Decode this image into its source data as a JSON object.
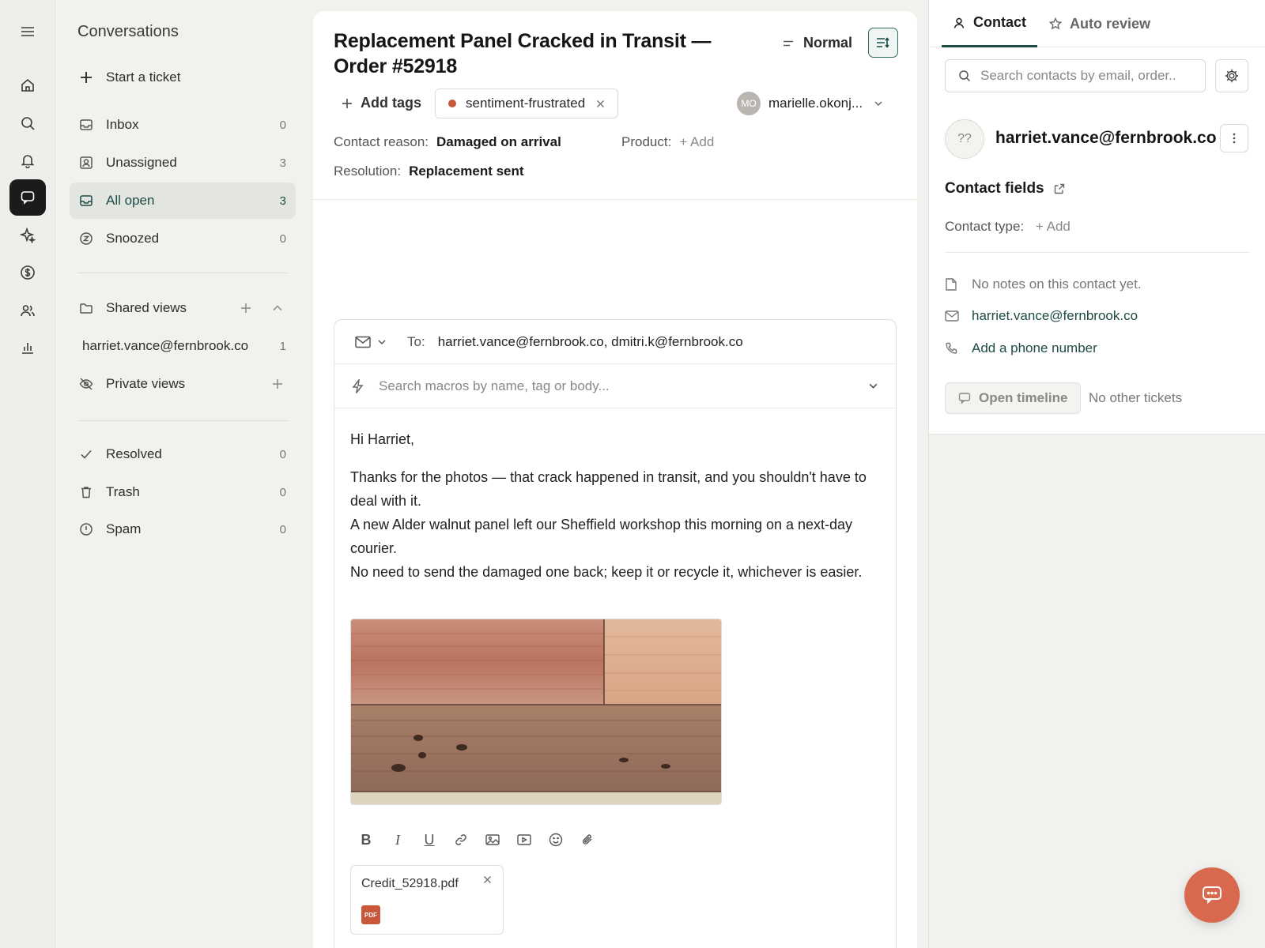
{
  "sidebar": {
    "title": "Conversations",
    "start_ticket": "Start a ticket",
    "items": [
      {
        "label": "Inbox",
        "count": "0"
      },
      {
        "label": "Unassigned",
        "count": "3"
      },
      {
        "label": "All open",
        "count": "3"
      },
      {
        "label": "Snoozed",
        "count": "0"
      }
    ],
    "shared_views": "Shared views",
    "shared_view_item": {
      "label": "harriet.vance@fernbrook.co",
      "count": "1"
    },
    "private_views": "Private views",
    "bottom_items": [
      {
        "label": "Resolved",
        "count": "0"
      },
      {
        "label": "Trash",
        "count": "0"
      },
      {
        "label": "Spam",
        "count": "0"
      }
    ]
  },
  "ticket": {
    "title": "Replacement Panel Cracked in Transit — Order #52918",
    "priority": "Normal",
    "add_tags": "Add tags",
    "tag": "sentiment-frustrated",
    "assignee_initials": "MO",
    "assignee": "marielle.okonj...",
    "contact_reason_label": "Contact reason:",
    "contact_reason_value": "Damaged on arrival",
    "product_label": "Product:",
    "product_add": "+ Add",
    "resolution_label": "Resolution:",
    "resolution_value": "Replacement sent"
  },
  "composer": {
    "to_label": "To:",
    "to_value": "harriet.vance@fernbrook.co, dmitri.k@fernbrook.co",
    "macro_placeholder": "Search macros by name, tag or body...",
    "greeting": "Hi Harriet,",
    "line1": "Thanks for the photos — that crack happened in transit, and you shouldn't have to deal with it.",
    "line2": "A new Alder walnut panel left our Sheffield workshop this morning on a next-day courier.",
    "line3": "No need to send the damaged one back; keep it or recycle it, whichever is easier.",
    "attachment_name": "Credit_52918.pdf",
    "attachment_type": "PDF"
  },
  "right_panel": {
    "tab_contact": "Contact",
    "tab_auto_review": "Auto review",
    "search_placeholder": "Search contacts by email, order..",
    "avatar_text": "??",
    "email": "harriet.vance@fernbrook.co",
    "contact_fields": "Contact fields",
    "contact_type_label": "Contact type:",
    "contact_type_add": "+ Add",
    "no_notes": "No notes on this contact yet.",
    "email_link": "harriet.vance@fernbrook.co",
    "add_phone": "Add a phone number",
    "open_timeline": "Open timeline",
    "no_other_tickets": "No other tickets"
  },
  "colors": {
    "accent": "#1d4b45",
    "tag_dot": "#c9573a",
    "fab": "#d9694e"
  }
}
